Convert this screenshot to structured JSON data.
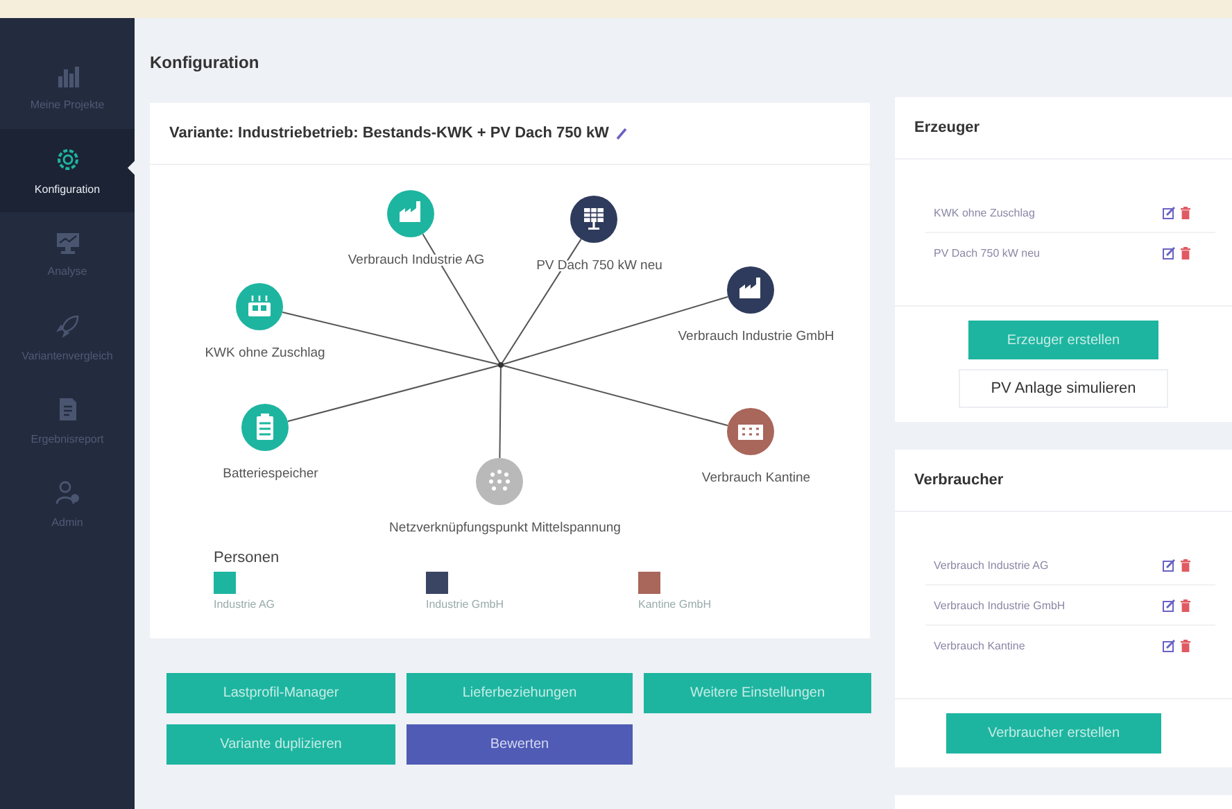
{
  "sidebar": {
    "items": [
      {
        "label": "Meine Projekte",
        "kind": "projects",
        "selected": false
      },
      {
        "label": "Konfiguration",
        "kind": "config",
        "selected": true
      },
      {
        "label": "Analyse",
        "kind": "analysis",
        "selected": false
      },
      {
        "label": "Variantenvergleich",
        "kind": "compare",
        "selected": false
      },
      {
        "label": "Ergebnisreport",
        "kind": "report",
        "selected": false
      },
      {
        "label": "Admin",
        "kind": "admin",
        "selected": false
      }
    ]
  },
  "page_title": "Konfiguration",
  "variant": {
    "title": "Variante: Industriebetrieb: Bestands-KWK + PV Dach 750 kW",
    "nodes": [
      {
        "label": "Verbrauch Industrie AG",
        "kind": "factory",
        "color": "#1db5a0"
      },
      {
        "label": "PV Dach 750 kW neu",
        "kind": "solar",
        "color": "#2f3b5c"
      },
      {
        "label": "Verbrauch Industrie GmbH",
        "kind": "factory",
        "color": "#2f3b5c"
      },
      {
        "label": "KWK ohne Zuschlag",
        "kind": "chp",
        "color": "#1db5a0"
      },
      {
        "label": "Batteriespeicher",
        "kind": "battery",
        "color": "#1db5a0"
      },
      {
        "label": "Netzverknüpfungspunkt Mittelspannung",
        "kind": "grid",
        "color": "#b9b9b9"
      },
      {
        "label": "Verbrauch Kantine",
        "kind": "canteen",
        "color": "#a9665a"
      }
    ],
    "legend_title": "Personen",
    "persons": [
      {
        "label": "Industrie AG",
        "color": "#1db5a0"
      },
      {
        "label": "Industrie GmbH",
        "color": "#3a4463"
      },
      {
        "label": "Kantine GmbH",
        "color": "#a9665a"
      }
    ]
  },
  "actions": [
    {
      "label": "Lastprofil-Manager",
      "kind": "primary"
    },
    {
      "label": "Lieferbeziehungen",
      "kind": "primary"
    },
    {
      "label": "Weitere Einstellungen",
      "kind": "primary"
    },
    {
      "label": "Variante duplizieren",
      "kind": "primary"
    },
    {
      "label": "Bewerten",
      "kind": "accent"
    }
  ],
  "producers": {
    "title": "Erzeuger",
    "items": [
      "KWK ohne Zuschlag",
      "PV Dach 750 kW neu"
    ],
    "create_button": "Erzeuger erstellen",
    "simulate_button": "PV Anlage simulieren"
  },
  "consumers": {
    "title": "Verbraucher",
    "items": [
      "Verbrauch Industrie AG",
      "Verbrauch Industrie GmbH",
      "Verbrauch Kantine"
    ],
    "create_button": "Verbraucher erstellen"
  }
}
